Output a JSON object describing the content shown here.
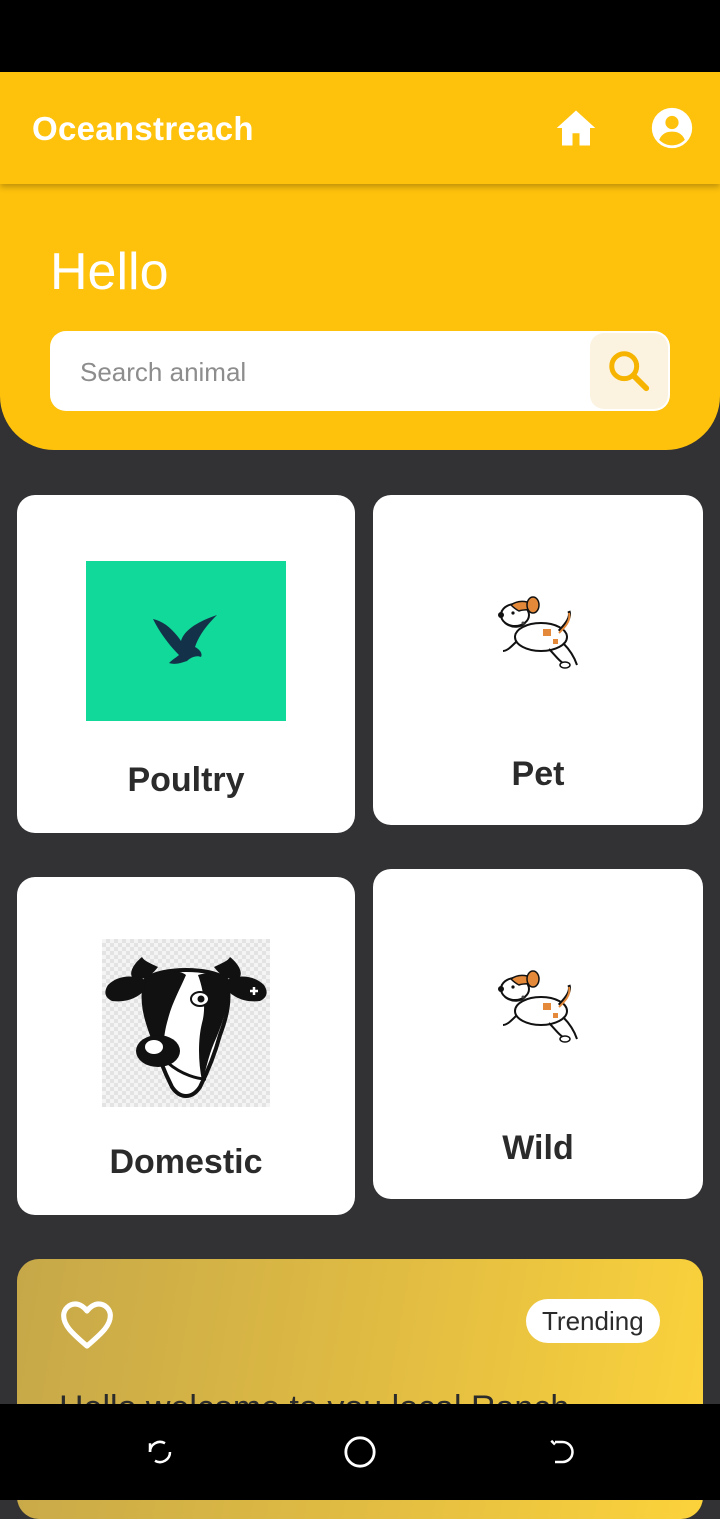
{
  "app_bar": {
    "title": "Oceanstreach",
    "icons": [
      "home-icon",
      "account-circle-icon"
    ]
  },
  "hero": {
    "greeting": "Hello",
    "search": {
      "placeholder": "Search animal",
      "value": "",
      "icon": "search-icon"
    }
  },
  "categories": [
    {
      "label": "Poultry",
      "image": "bird-image"
    },
    {
      "label": "Pet",
      "image": "dog-image"
    },
    {
      "label": "Domestic",
      "image": "cow-image"
    },
    {
      "label": "Wild",
      "image": "dog-image"
    }
  ],
  "trending": {
    "icon": "heart-outline-icon",
    "badge": "Trending",
    "text": "Hello welcome to you local Ranch"
  },
  "nav": {
    "icons": [
      "recent-apps-icon",
      "home-circle-icon",
      "back-icon"
    ]
  },
  "colors": {
    "accent": "#FEC20C",
    "background": "#323134",
    "card": "#FFFFFF",
    "bird_tile": "#11D999"
  }
}
